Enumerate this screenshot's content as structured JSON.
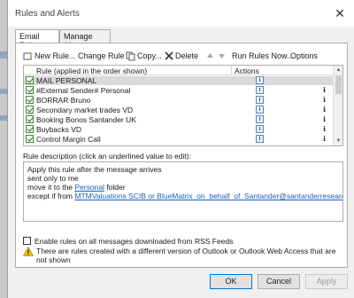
{
  "window": {
    "title": "Rules and Alerts",
    "close_symbol": "✕"
  },
  "tabs": [
    {
      "label": "Email Rules",
      "active": true
    },
    {
      "label": "Manage Alerts",
      "active": false
    }
  ],
  "toolbar": {
    "new_rule": "New Rule...",
    "change_rule": "Change Rule",
    "copy": "Copy...",
    "delete": "Delete",
    "run_rules_now": "Run Rules Now...",
    "options": "Options"
  },
  "rules_table": {
    "col_rule": "Rule (applied in the order shown)",
    "col_actions": "Actions",
    "rows": [
      {
        "name": "MAIL PERSONAL",
        "checked": true,
        "selected": true,
        "flag": ""
      },
      {
        "name": "#External Sender# Personal",
        "checked": true,
        "selected": false,
        "flag": "ℹ"
      },
      {
        "name": "BORRAR Bruno",
        "checked": true,
        "selected": false,
        "flag": "ℹ"
      },
      {
        "name": "Secondary market trades VD",
        "checked": true,
        "selected": false,
        "flag": "ℹ"
      },
      {
        "name": "Booking Bonos Santander UK",
        "checked": true,
        "selected": false,
        "flag": "ℹ"
      },
      {
        "name": "Buybacks VD",
        "checked": true,
        "selected": false,
        "flag": "ℹ"
      },
      {
        "name": "Control Margin Call",
        "checked": true,
        "selected": false,
        "flag": "ℹ"
      }
    ]
  },
  "description": {
    "label": "Rule description (click an underlined value to edit):",
    "line1": "Apply this rule after the message arrives",
    "line2": "sent only to me",
    "line3_prefix": "move it to the ",
    "line3_link": "Personal",
    "line3_suffix": " folder",
    "line4_prefix": "except if from ",
    "line4_link": "MTMValuations SCIB or BlueMatrix_on_behalf_of_Santander@santanderresearch.bluematrix"
  },
  "rss_checkbox": {
    "label": "Enable rules on all messages downloaded from RSS Feeds",
    "checked": false
  },
  "warning": {
    "text": "There are rules created with a different version of Outlook or Outlook Web Access that are not shown"
  },
  "buttons": {
    "ok": "OK",
    "cancel": "Cancel",
    "apply": "Apply"
  }
}
